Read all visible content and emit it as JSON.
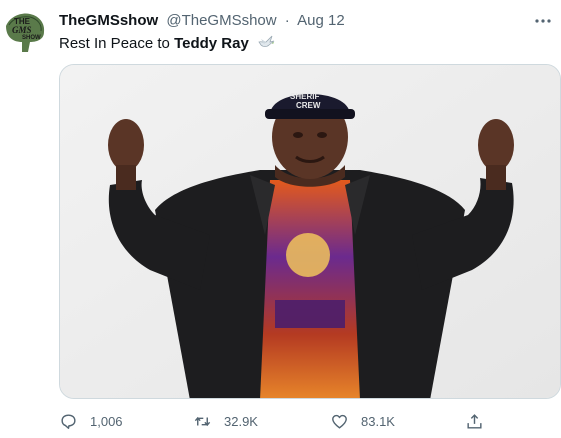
{
  "user": {
    "display_name": "TheGMSshow",
    "handle": "@TheGMSshow",
    "separator": "·",
    "date": "Aug 12",
    "avatar_text": [
      "THE",
      "GMS",
      "SHOW"
    ]
  },
  "tweet": {
    "text_prefix": "Rest In Peace to ",
    "text_bold": "Teddy Ray",
    "emoji": "dove-emoji"
  },
  "media": {
    "hat_text": "SHERIF\nCREW"
  },
  "actions": {
    "reply_count": "1,006",
    "retweet_count": "32.9K",
    "like_count": "83.1K"
  },
  "colors": {
    "text_primary": "#0f1419",
    "text_secondary": "#536471",
    "border": "#cfd9de",
    "media_background": "#ededed"
  },
  "icons": [
    "more-icon",
    "dove-emoji",
    "reply-icon",
    "retweet-icon",
    "like-icon",
    "share-icon"
  ]
}
